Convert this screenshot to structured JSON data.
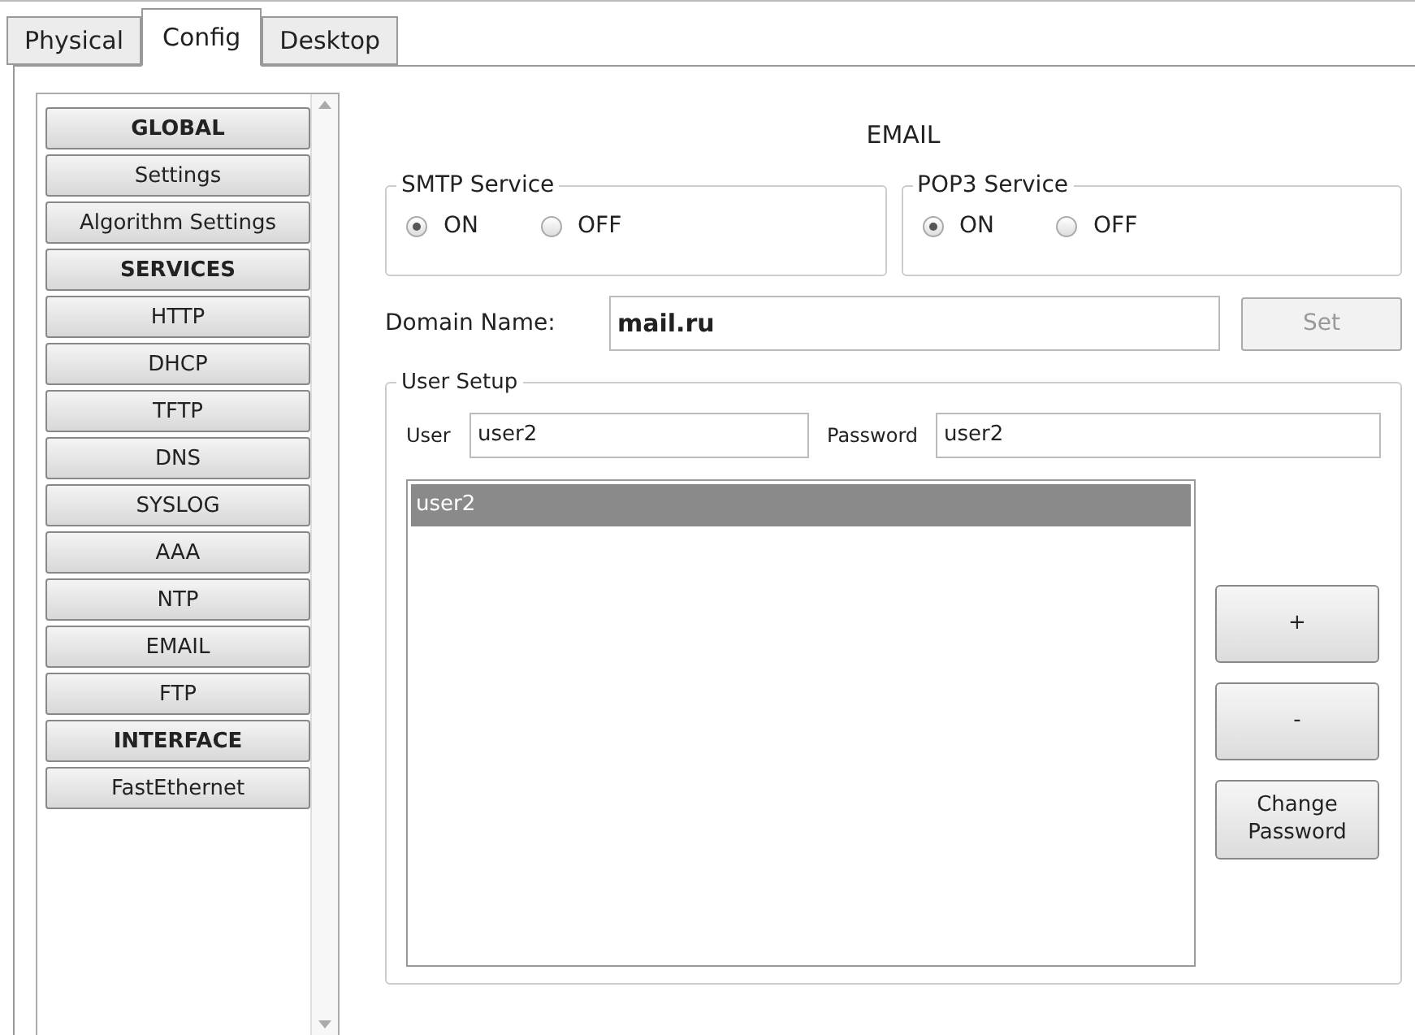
{
  "tabs": [
    {
      "label": "Physical",
      "selected": false
    },
    {
      "label": "Config",
      "selected": true
    },
    {
      "label": "Desktop",
      "selected": false
    }
  ],
  "sidebar": {
    "items": [
      {
        "label": "GLOBAL",
        "kind": "heading"
      },
      {
        "label": "Settings",
        "kind": "item"
      },
      {
        "label": "Algorithm Settings",
        "kind": "item"
      },
      {
        "label": "SERVICES",
        "kind": "heading"
      },
      {
        "label": "HTTP",
        "kind": "item"
      },
      {
        "label": "DHCP",
        "kind": "item"
      },
      {
        "label": "TFTP",
        "kind": "item"
      },
      {
        "label": "DNS",
        "kind": "item"
      },
      {
        "label": "SYSLOG",
        "kind": "item"
      },
      {
        "label": "AAA",
        "kind": "item"
      },
      {
        "label": "NTP",
        "kind": "item"
      },
      {
        "label": "EMAIL",
        "kind": "item"
      },
      {
        "label": "FTP",
        "kind": "item"
      },
      {
        "label": "INTERFACE",
        "kind": "heading"
      },
      {
        "label": "FastEthernet",
        "kind": "item"
      }
    ]
  },
  "title": "EMAIL",
  "services": [
    {
      "label": "SMTP Service",
      "options": [
        {
          "label": "ON",
          "selected": true
        },
        {
          "label": "OFF",
          "selected": false
        }
      ]
    },
    {
      "label": "POP3 Service",
      "options": [
        {
          "label": "ON",
          "selected": true
        },
        {
          "label": "OFF",
          "selected": false
        }
      ]
    }
  ],
  "domain": {
    "label": "Domain Name:",
    "value": "mail.ru",
    "button": {
      "label": "Set",
      "disabled": true
    }
  },
  "user_setup": {
    "label": "User Setup",
    "user_label": "User",
    "user_value": "user2",
    "password_label": "Password",
    "password_value": "user2",
    "users": [
      {
        "label": "user2",
        "selected": true
      }
    ],
    "buttons": [
      "+",
      "-",
      "Change Password"
    ]
  }
}
